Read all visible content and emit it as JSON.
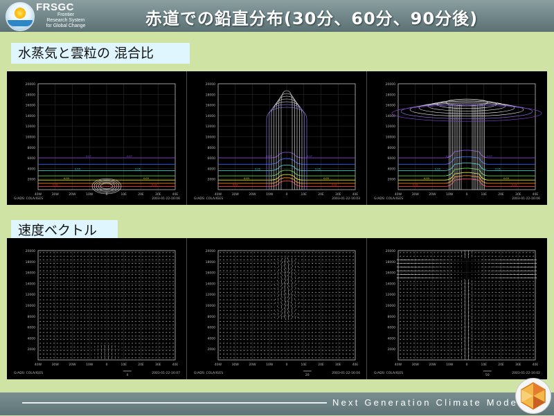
{
  "header": {
    "brand": "FRSGC",
    "brand_sub_lines": [
      "Frontier",
      "Research System",
      "for Global Change"
    ],
    "title": "赤道での鉛直分布(30分、60分、90分後)"
  },
  "sections": {
    "mixing_ratio_label": "水蒸気と雲粒の 混合比",
    "velocity_label": "速度ベクトル"
  },
  "chart_data": [
    {
      "type": "contour",
      "panel": "mixing-ratio-30min",
      "ylim": [
        0,
        20000
      ],
      "yticks": [
        "2000",
        "4000",
        "6000",
        "8000",
        "10000",
        "12000",
        "14000",
        "16000",
        "18000",
        "20000"
      ],
      "xticks": [
        "40W",
        "30W",
        "20W",
        "10W",
        "0",
        "10E",
        "20E",
        "30E",
        "40E"
      ],
      "footer_left": "GrADS: COLA/IGES",
      "footer_right": "2003-01-22-16:06"
    },
    {
      "type": "contour",
      "panel": "mixing-ratio-60min",
      "ylim": [
        0,
        20000
      ],
      "yticks": [
        "2000",
        "4000",
        "6000",
        "8000",
        "10000",
        "12000",
        "14000",
        "16000",
        "18000",
        "20000"
      ],
      "xticks": [
        "40W",
        "30W",
        "20W",
        "10W",
        "0",
        "10E",
        "20E",
        "30E",
        "40E"
      ],
      "footer_left": "GrADS: COLA/IGES",
      "footer_right": "2003-01-22-16:03"
    },
    {
      "type": "contour",
      "panel": "mixing-ratio-90min",
      "ylim": [
        0,
        20000
      ],
      "yticks": [
        "2000",
        "4000",
        "6000",
        "8000",
        "10000",
        "12000",
        "14000",
        "16000",
        "18000",
        "20000"
      ],
      "xticks": [
        "40W",
        "30W",
        "20W",
        "10W",
        "0",
        "10E",
        "20E",
        "30E",
        "40E"
      ],
      "footer_left": "GrADS: COLA/IGES",
      "footer_right": "2003-01-22-16:06"
    },
    {
      "type": "vector",
      "panel": "velocity-30min",
      "ylim": [
        0,
        20000
      ],
      "yticks": [
        "2000",
        "4000",
        "6000",
        "8000",
        "10000",
        "12000",
        "14000",
        "16000",
        "18000",
        "20000"
      ],
      "xticks": [
        "40W",
        "30W",
        "20W",
        "10W",
        "0",
        "10E",
        "20E",
        "30E",
        "40E"
      ],
      "reference_vector": "4",
      "footer_left": "GrADS: COLA/IGES",
      "footer_right": "2003-01-22-16:07"
    },
    {
      "type": "vector",
      "panel": "velocity-60min",
      "ylim": [
        0,
        20000
      ],
      "yticks": [
        "2000",
        "4000",
        "6000",
        "8000",
        "10000",
        "12000",
        "14000",
        "16000",
        "18000",
        "20000"
      ],
      "xticks": [
        "40W",
        "30W",
        "20W",
        "10W",
        "0",
        "10E",
        "20E",
        "30E",
        "40E"
      ],
      "reference_vector": "20",
      "footer_left": "GrADS: COLA/IGES",
      "footer_right": "2003-01-22-16:04"
    },
    {
      "type": "vector",
      "panel": "velocity-90min",
      "ylim": [
        0,
        20000
      ],
      "yticks": [
        "2000",
        "4000",
        "6000",
        "8000",
        "10000",
        "12000",
        "14000",
        "16000",
        "18000",
        "20000"
      ],
      "xticks": [
        "40W",
        "30W",
        "20W",
        "10W",
        "0",
        "10E",
        "20E",
        "30E",
        "40E"
      ],
      "reference_vector": "50",
      "footer_left": "GrADS: COLA/IGES",
      "footer_right": "2003-01-22-16:02"
    }
  ],
  "footer": {
    "tagline": "Next Generation Climate Model"
  },
  "colors": {
    "contour_levels": [
      "#ff3344",
      "#ff8a00",
      "#e8e800",
      "#55dd33",
      "#22cccc",
      "#3366ff",
      "#8844dd"
    ]
  }
}
